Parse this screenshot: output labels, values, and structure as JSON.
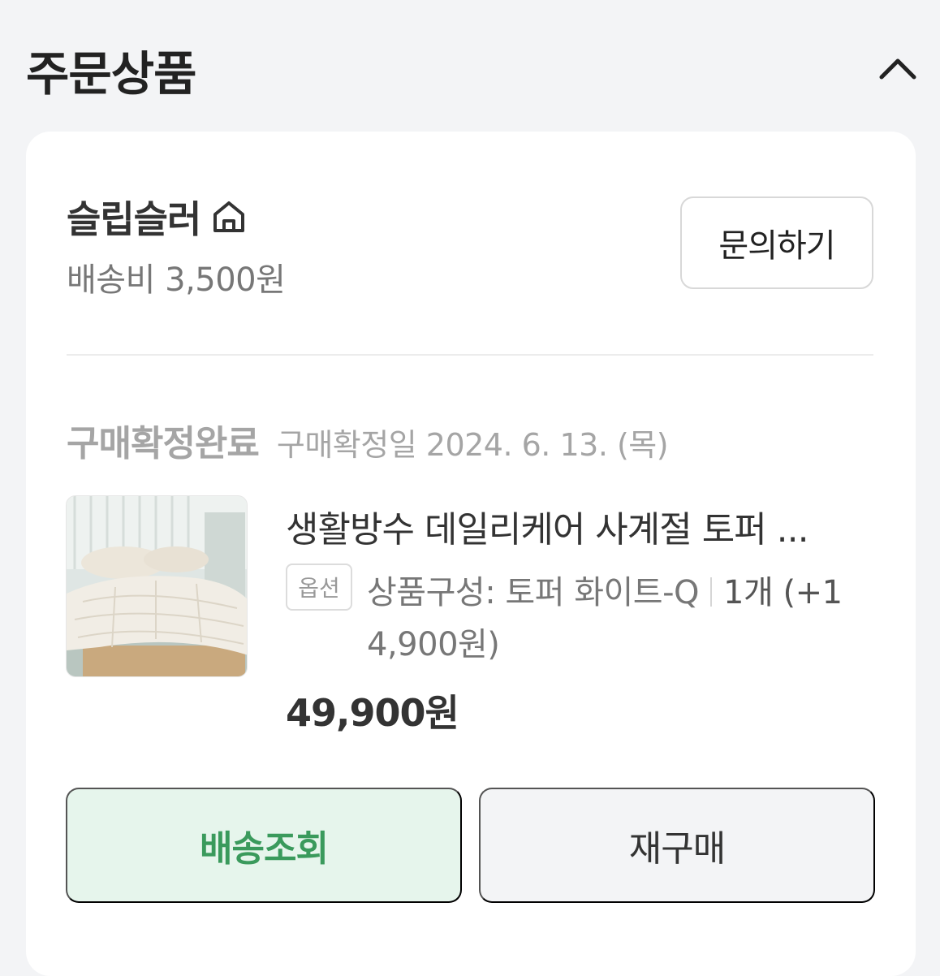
{
  "header": {
    "title": "주문상품",
    "collapse_icon": "chevron-up-icon"
  },
  "seller": {
    "name": "슬립슬러",
    "icon": "home-icon",
    "shipping_fee": "배송비 3,500원",
    "inquiry_label": "문의하기"
  },
  "order": {
    "status": "구매확정완료",
    "confirmed_date": "구매확정일 2024. 6. 13. (목)"
  },
  "product": {
    "name": "생활방수 데일리케어 사계절 토퍼 ...",
    "option_badge": "옵션",
    "option_label": "상품구성: 토퍼 화이트-Q",
    "quantity": "1개 (+1",
    "option_extra": "4,900원)",
    "price": "49,900원"
  },
  "actions": {
    "track_label": "배송조회",
    "rebuy_label": "재구매"
  },
  "colors": {
    "accent_green": "#3a9a5c",
    "accent_green_bg": "#e6f5ec"
  }
}
